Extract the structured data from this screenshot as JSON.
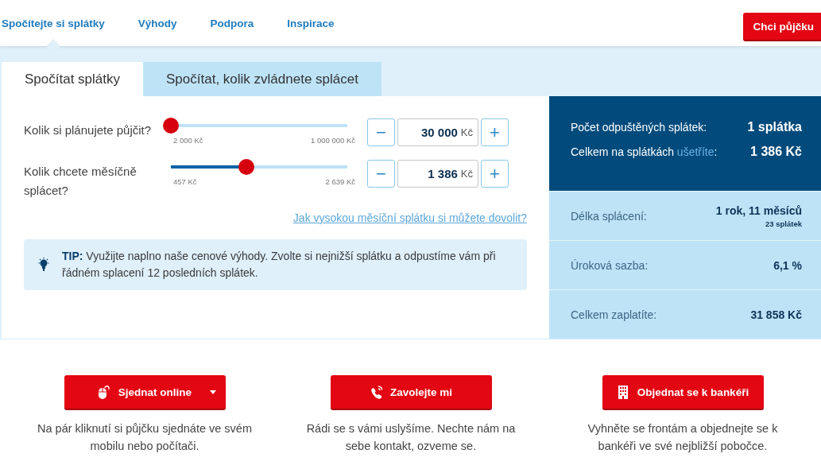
{
  "nav": {
    "items": [
      {
        "label": "Spočítejte si splátky",
        "selected": true
      },
      {
        "label": "Výhody",
        "selected": false
      },
      {
        "label": "Podpora",
        "selected": false
      },
      {
        "label": "Inspirace",
        "selected": false
      }
    ],
    "cta_button": "Chci půjčku"
  },
  "tabs": [
    {
      "label": "Spočítat splátky",
      "selected": true
    },
    {
      "label": "Spočítat, kolik zvládnete splácet",
      "selected": false
    }
  ],
  "sliders": [
    {
      "label": "Kolik si plánujete půjčit?",
      "level": 0.0,
      "min_label": "2 000 Kč",
      "max_label": "1 000 000 Kč",
      "value": "30 000",
      "unit": "Kč",
      "minus": "−",
      "plus": "+"
    },
    {
      "label": "Kolik chcete měsíčně splácet?",
      "level": 0.43,
      "min_label": "457 Kč",
      "max_label": "2 639 Kč",
      "value": "1 386",
      "unit": "Kč",
      "minus": "−",
      "plus": "+"
    }
  ],
  "help_link": "Jak vysokou měsíční splátku si můžete dovolit?",
  "tip": {
    "text": "**TIP:** Využijte naplno naše cenové výhody. Zvolte si nejnižší splátku a odpustíme vám při řádném splacení 12 posledních splátek."
  },
  "summary": {
    "highlights": [
      {
        "label": "Počet odpuštěných splátek:",
        "value": "1 splátka"
      },
      {
        "label": "Celkem na splátkách",
        "link": "ušetříte",
        "label_end": ":",
        "value": "1 386 Kč"
      }
    ],
    "details": [
      {
        "label": "Délka splácení:",
        "value": "1 rok, 11 měsíců",
        "note": "23 splátek"
      },
      {
        "label": "Úroková sazba:",
        "value": "6,1 %"
      },
      {
        "label": "Celkem zaplatíte:",
        "value": "31 858 Kč"
      }
    ]
  },
  "actions": [
    {
      "kind": "mouse",
      "label": "Sjednat online",
      "dropdown": true,
      "description": "Na pár kliknutí si půjčku sjednáte ve svém mobilu nebo počítači."
    },
    {
      "kind": "phone",
      "label": "Zavolejte mi",
      "dropdown": false,
      "description": "Rádi se s vámi uslyšíme. Nechte nám na sebe kontakt, ozveme se."
    },
    {
      "kind": "building",
      "label": "Objednat se k bankéři",
      "dropdown": false,
      "description": "Vyhněte se frontám a objednejte se k bankéři ve své nejbližší pobočce."
    }
  ]
}
